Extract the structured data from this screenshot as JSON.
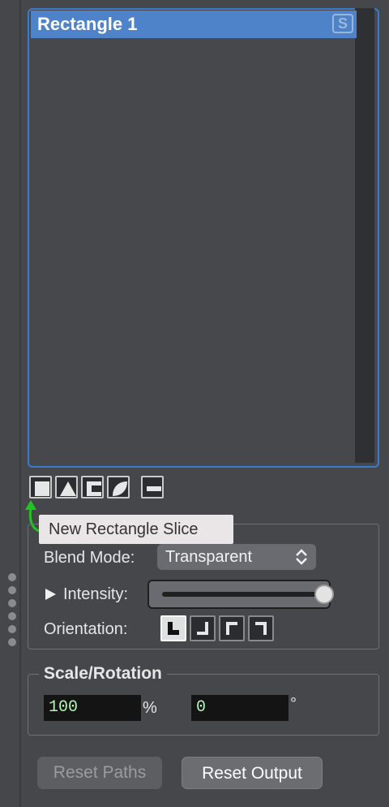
{
  "slice_list": {
    "items": [
      {
        "label": "Rectangle 1",
        "badge": "S",
        "selected": true
      }
    ]
  },
  "tools": [
    {
      "icon": "square-icon",
      "tooltip": "New Rectangle Slice"
    },
    {
      "icon": "triangle-icon"
    },
    {
      "icon": "bracket-icon"
    },
    {
      "icon": "leaf-icon"
    },
    {
      "icon": "minus-icon"
    }
  ],
  "tooltip": {
    "text": "New Rectangle Slice"
  },
  "blend": {
    "label": "Blend Mode:",
    "value": "Transparent",
    "intensity_label": "Intensity:",
    "intensity": 1.0,
    "orientation_label": "Orientation:",
    "orientation_selected": 0
  },
  "scale_rotation": {
    "title": "Scale/Rotation",
    "scale": "100",
    "scale_unit": "%",
    "rotation": "0",
    "rotation_unit": "°"
  },
  "buttons": {
    "reset_paths": "Reset Paths",
    "reset_output": "Reset Output"
  },
  "colors": {
    "accent": "#3b7ad1",
    "selection": "#4f83c9",
    "annotation_arrow": "#22c322"
  }
}
